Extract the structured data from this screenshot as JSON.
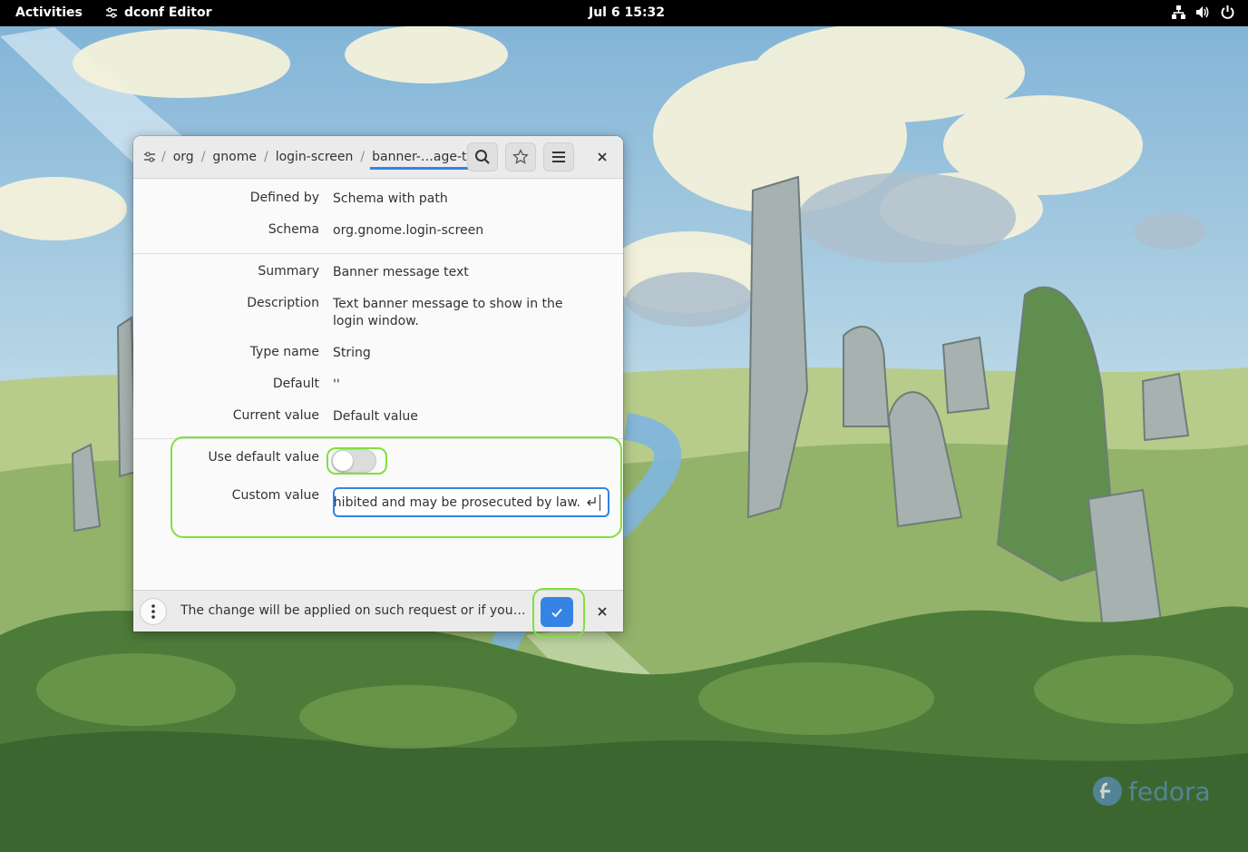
{
  "topbar": {
    "activities": "Activities",
    "app_name": "dconf Editor",
    "clock": "Jul 6  15:32"
  },
  "window": {
    "breadcrumbs": [
      "org",
      "gnome",
      "login-screen",
      "banner-…age-text"
    ],
    "details": {
      "defined_by": {
        "label": "Defined by",
        "value": "Schema with path"
      },
      "schema": {
        "label": "Schema",
        "value": "org.gnome.login-screen"
      },
      "summary": {
        "label": "Summary",
        "value": "Banner message text"
      },
      "description": {
        "label": "Description",
        "value": "Text banner message to show in the login window."
      },
      "type_name": {
        "label": "Type name",
        "value": "String"
      },
      "default": {
        "label": "Default",
        "value": "''"
      },
      "current_value": {
        "label": "Current value",
        "value": "Default value"
      }
    },
    "use_default": {
      "label": "Use default value",
      "enabled": false
    },
    "custom_value": {
      "label": "Custom value",
      "value": "prohibited and may be prosecuted by law."
    },
    "footer": {
      "message": "The change will be applied on such request or if you quit t…"
    }
  },
  "wallpaper": {
    "brand": "fedora"
  },
  "colors": {
    "accent": "#3584e4",
    "highlight": "#7fe13c"
  }
}
